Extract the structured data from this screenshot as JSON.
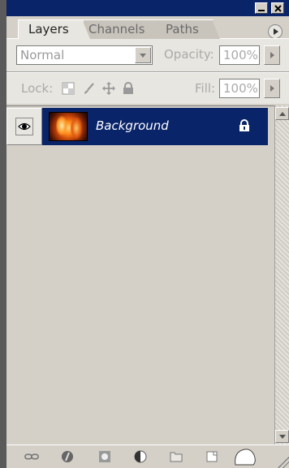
{
  "tabs": [
    {
      "label": "Layers",
      "active": true
    },
    {
      "label": "Channels",
      "active": false
    },
    {
      "label": "Paths",
      "active": false
    }
  ],
  "blend": {
    "mode": "Normal",
    "opacity_label": "Opacity:",
    "opacity_value": "100%"
  },
  "lock": {
    "label": "Lock:",
    "fill_label": "Fill:",
    "fill_value": "100%"
  },
  "layers": [
    {
      "name": "Background",
      "visible": true,
      "locked": true,
      "selected": true
    }
  ],
  "colors": {
    "title_bar": "#0a246a",
    "selection": "#0a246a",
    "panel_bg": "#d4d0c8"
  },
  "bottom_icons": [
    "link-layers-icon",
    "layer-style-icon",
    "layer-mask-icon",
    "adjustment-layer-icon",
    "new-group-icon",
    "new-layer-icon",
    "delete-layer-icon"
  ]
}
